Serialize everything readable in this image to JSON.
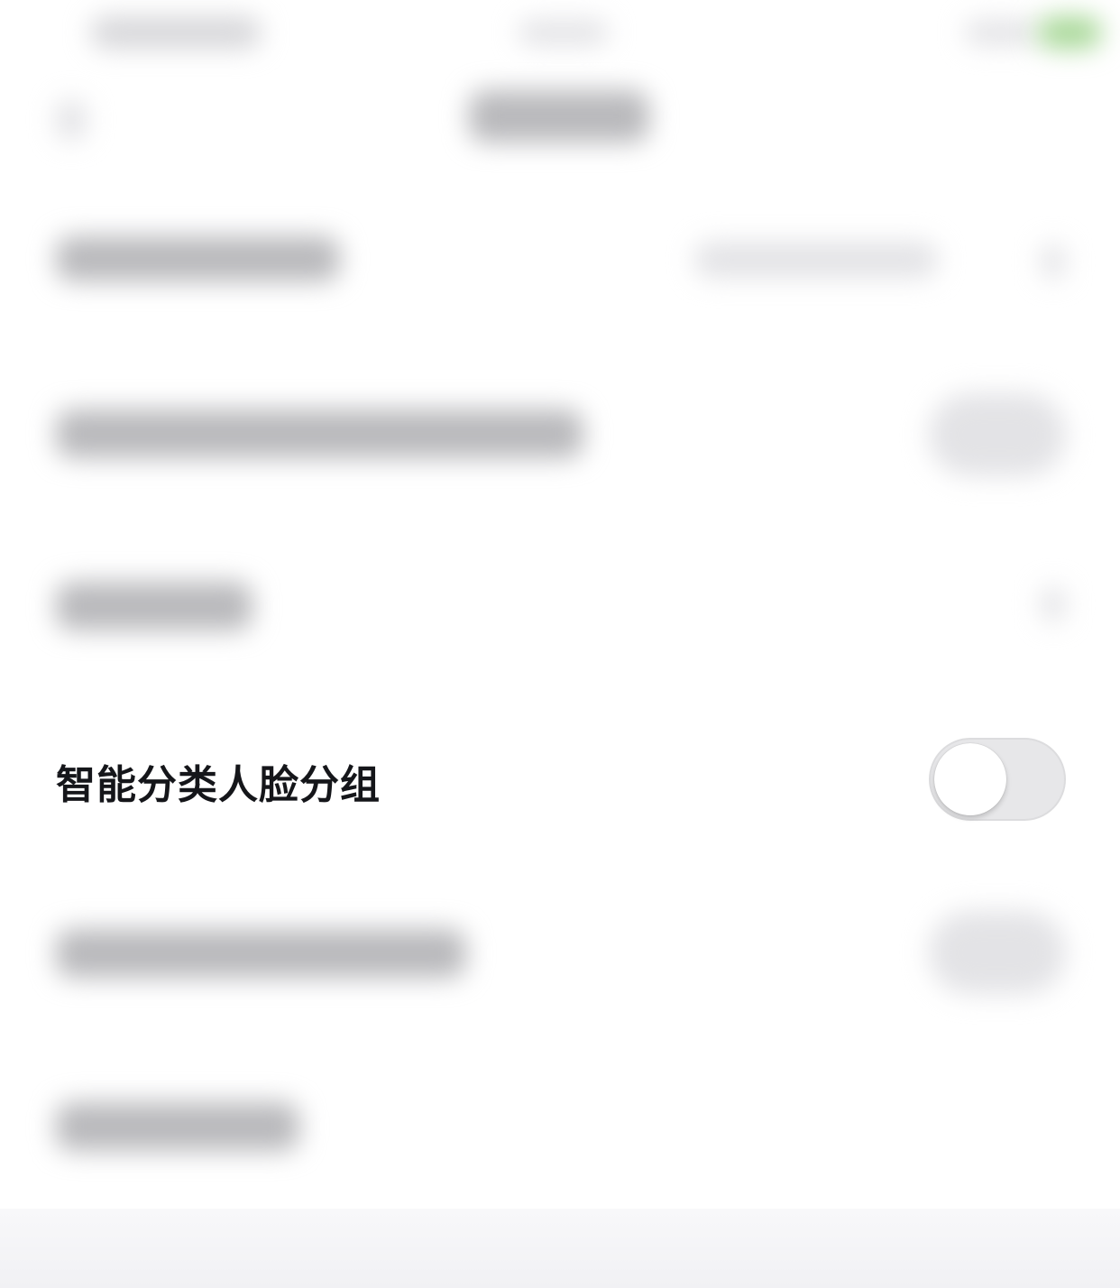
{
  "face_grouping": {
    "label": "智能分类人脸分组",
    "toggle_on": false,
    "toggle_off_color": "#e7e7e9",
    "knob_color": "#ffffff"
  },
  "colors": {
    "background": "#ffffff",
    "text": "#15161a",
    "status_accent": "#a8d898"
  }
}
